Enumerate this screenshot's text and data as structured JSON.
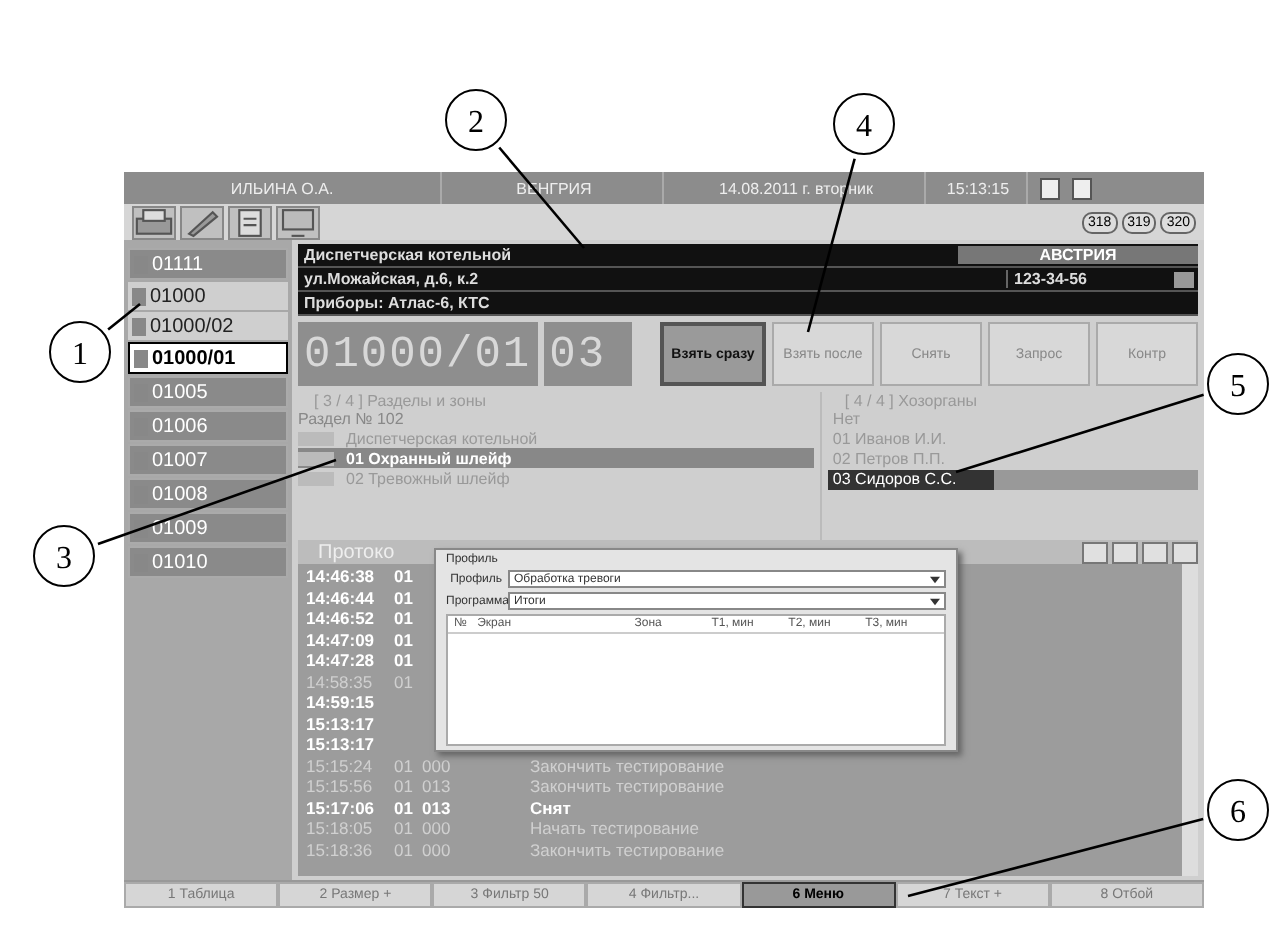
{
  "top_bar": {
    "operator": "ИЛЬИНА О.А.",
    "country": "ВЕНГРИЯ",
    "date": "14.08.2011 г. вторник",
    "time": "15:13:15"
  },
  "toolbar": {
    "badges": [
      "318",
      "319",
      "320"
    ]
  },
  "sidebar": {
    "items": [
      {
        "label": "01111",
        "selected": false,
        "active": false
      },
      {
        "label": "01000",
        "selected": false,
        "active": true
      },
      {
        "label": "01000/02",
        "selected": false,
        "active": true
      },
      {
        "label": "01000/01",
        "selected": true,
        "active": true
      },
      {
        "label": "01005",
        "selected": false,
        "active": false
      },
      {
        "label": "01006",
        "selected": false,
        "active": false
      },
      {
        "label": "01007",
        "selected": false,
        "active": false
      },
      {
        "label": "01008",
        "selected": false,
        "active": false
      },
      {
        "label": "01009",
        "selected": false,
        "active": false
      },
      {
        "label": "01010",
        "selected": false,
        "active": false
      }
    ]
  },
  "info": {
    "name": "Диспетчерская котельной",
    "country": "АВСТРИЯ",
    "address": "ул.Можайская, д.6, к.2",
    "phone": "123-34-56",
    "devices": "Приборы: Атлас-6, КТС"
  },
  "display": {
    "number": "01000/01",
    "zone": "03"
  },
  "actions": [
    {
      "label": "Взять сразу",
      "selected": true
    },
    {
      "label": "Взять после",
      "selected": false
    },
    {
      "label": "Снять",
      "selected": false
    },
    {
      "label": "Запрос",
      "selected": false
    },
    {
      "label": "Контр",
      "selected": false
    }
  ],
  "sections": {
    "title": "[ 3 / 4 ]  Разделы и зоны",
    "header": "Раздел № 102",
    "rows": [
      {
        "label": "Диспетчерская котельной",
        "selected": false
      },
      {
        "label": "01  Охранный шлейф",
        "selected": true
      },
      {
        "label": "02  Тревожный шлейф",
        "selected": false
      }
    ]
  },
  "hosts": {
    "title": "[ 4 / 4 ]  Хозорганы",
    "rows": [
      {
        "label": "Нет",
        "selected": false
      },
      {
        "label": "01 Иванов И.И.",
        "selected": false
      },
      {
        "label": "02 Петров П.П.",
        "selected": false
      },
      {
        "label": "03 Сидоров С.С.",
        "selected": true
      }
    ]
  },
  "protocol": {
    "title": "Протоко",
    "rows": [
      {
        "time": "14:46:38",
        "part": "01",
        "code": "",
        "text": "",
        "bright": true
      },
      {
        "time": "14:46:44",
        "part": "01",
        "code": "",
        "text": "",
        "bright": true
      },
      {
        "time": "14:46:52",
        "part": "01",
        "code": "",
        "text": "",
        "bright": true
      },
      {
        "time": "14:47:09",
        "part": "01",
        "code": "",
        "text": "",
        "bright": true
      },
      {
        "time": "14:47:28",
        "part": "01",
        "code": "",
        "text": "",
        "bright": true
      },
      {
        "time": "14:58:35",
        "part": "01",
        "code": "",
        "text": "",
        "bright": false
      },
      {
        "time": "14:59:15",
        "part": "",
        "code": "",
        "text": "",
        "bright": true
      },
      {
        "time": "15:13:17",
        "part": "",
        "code": "",
        "text": "",
        "bright": true
      },
      {
        "time": "15:13:17",
        "part": "",
        "code": "",
        "text": "",
        "bright": true
      },
      {
        "time": "15:15:24",
        "part": "01",
        "code": "000",
        "text": "Закончить тестирование",
        "bright": false
      },
      {
        "time": "15:15:56",
        "part": "01",
        "code": "013",
        "text": "Закончить тестирование",
        "bright": false
      },
      {
        "time": "15:17:06",
        "part": "01",
        "code": "013",
        "text": "Снят",
        "bright": true
      },
      {
        "time": "15:18:05",
        "part": "01",
        "code": "000",
        "text": "Начать тестирование",
        "bright": false
      },
      {
        "time": "15:18:36",
        "part": "01",
        "code": "000",
        "text": "Закончить тестирование",
        "bright": false
      }
    ]
  },
  "dialog": {
    "title": "Профиль",
    "fields": [
      {
        "label": "Профиль",
        "value": "Обработка тревоги"
      },
      {
        "label": "Программа",
        "value": "Итоги"
      }
    ],
    "columns": [
      "№",
      "Экран",
      "Зона",
      "T1, мин",
      "T2, мин",
      "T3, мин"
    ]
  },
  "function_keys": [
    {
      "label": "1 Таблица",
      "selected": false
    },
    {
      "label": "2 Размер +",
      "selected": false
    },
    {
      "label": "3 Фильтр 50",
      "selected": false
    },
    {
      "label": "4 Фильтр...",
      "selected": false
    },
    {
      "label": "6 Меню",
      "selected": true
    },
    {
      "label": "7 Текст +",
      "selected": false
    },
    {
      "label": "8 Отбой",
      "selected": false
    }
  ],
  "callouts": [
    {
      "number": "1"
    },
    {
      "number": "2"
    },
    {
      "number": "3"
    },
    {
      "number": "4"
    },
    {
      "number": "5"
    },
    {
      "number": "6"
    }
  ]
}
